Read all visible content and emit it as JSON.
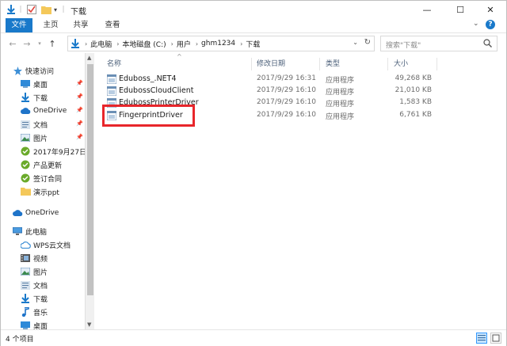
{
  "window": {
    "title": "下载",
    "controls": {
      "minimize": "—",
      "maximize": "☐",
      "close": "✕"
    }
  },
  "ribbon": {
    "tabs": [
      "文件",
      "主页",
      "共享",
      "查看"
    ],
    "active_tab": "文件",
    "help": "?"
  },
  "address": {
    "breadcrumbs": [
      "此电脑",
      "本地磁盘 (C:)",
      "用户",
      "ghm1234",
      "下载"
    ],
    "search_placeholder": "搜索\"下载\""
  },
  "nav": {
    "quick_access": "快速访问",
    "items": [
      {
        "label": "桌面",
        "icon": "desktop-icon",
        "pinned": true
      },
      {
        "label": "下载",
        "icon": "download-arrow-icon",
        "pinned": true
      },
      {
        "label": "OneDrive",
        "icon": "cloud-icon",
        "pinned": true
      },
      {
        "label": "文档",
        "icon": "document-icon",
        "pinned": true
      },
      {
        "label": "图片",
        "icon": "picture-icon",
        "pinned": true
      },
      {
        "label": "2017年9月27日",
        "icon": "wps-folder-icon",
        "pinned": false
      },
      {
        "label": "产品更新",
        "icon": "wps-folder-icon",
        "pinned": false
      },
      {
        "label": "签订合同",
        "icon": "wps-folder-icon",
        "pinned": false
      },
      {
        "label": "演示ppt",
        "icon": "folder-icon",
        "pinned": false
      }
    ],
    "onedrive": "OneDrive",
    "this_pc": "此电脑",
    "pc_items": [
      {
        "label": "WPS云文档",
        "icon": "wps-cloud-icon"
      },
      {
        "label": "视频",
        "icon": "video-icon"
      },
      {
        "label": "图片",
        "icon": "picture-icon"
      },
      {
        "label": "文档",
        "icon": "document-icon"
      },
      {
        "label": "下载",
        "icon": "download-arrow-icon"
      },
      {
        "label": "音乐",
        "icon": "music-icon"
      },
      {
        "label": "桌面",
        "icon": "desktop-icon"
      }
    ]
  },
  "columns": {
    "name": "名称",
    "date": "修改日期",
    "type": "类型",
    "size": "大小"
  },
  "files": [
    {
      "name": "Eduboss_.NET4",
      "date": "2017/9/29 16:31",
      "type": "应用程序",
      "size": "49,268 KB"
    },
    {
      "name": "EdubossCloudClient",
      "date": "2017/9/29 16:10",
      "type": "应用程序",
      "size": "21,010 KB"
    },
    {
      "name": "EdubossPrinterDriver",
      "date": "2017/9/29 16:10",
      "type": "应用程序",
      "size": "1,583 KB"
    },
    {
      "name": "FingerprintDriver",
      "date": "2017/9/29 16:10",
      "type": "应用程序",
      "size": "6,761 KB"
    }
  ],
  "status": {
    "item_count": "4 个项目"
  },
  "colors": {
    "accent": "#1979ca",
    "highlight": "#e8262b"
  }
}
